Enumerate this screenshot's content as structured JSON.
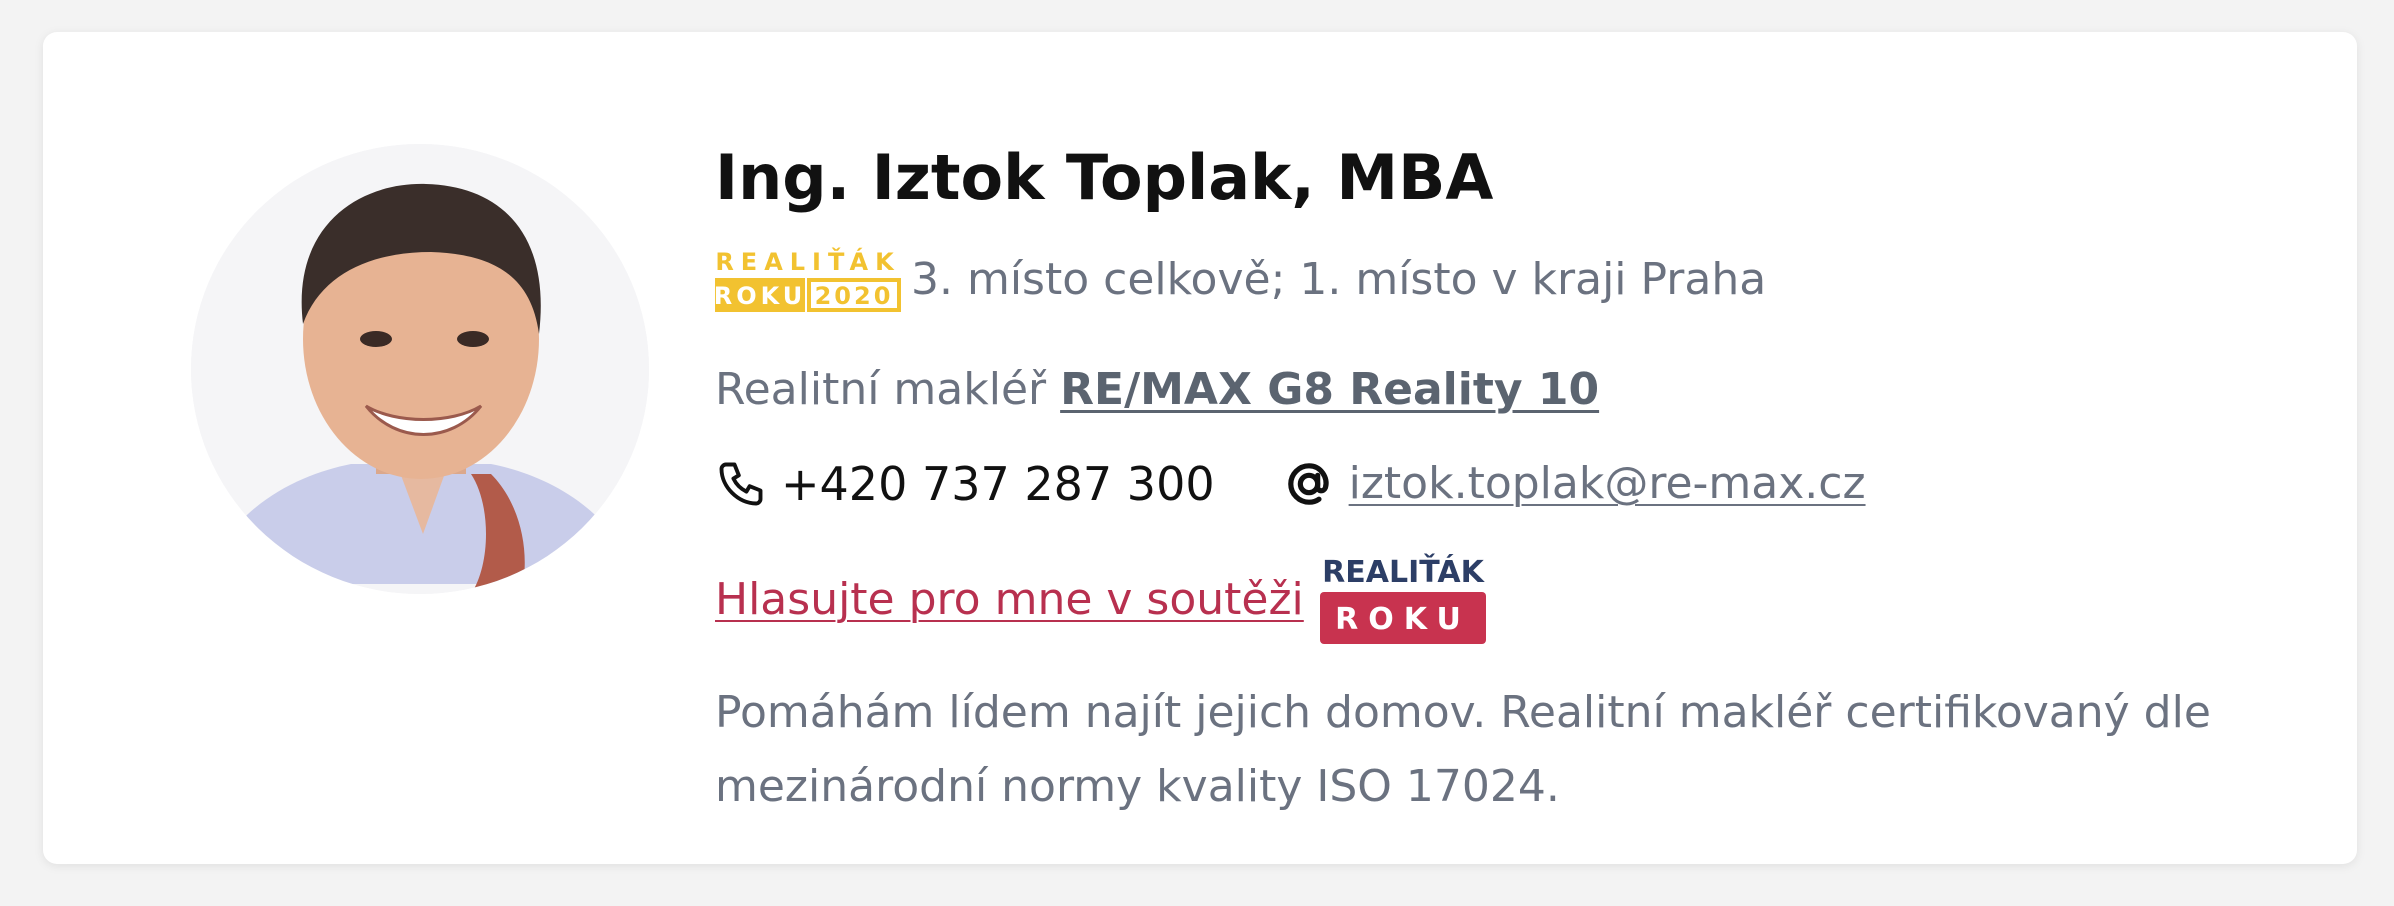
{
  "agent": {
    "name": "Ing. Iztok Toplak, MBA",
    "award_badge": {
      "line1": "REALIŤÁK",
      "line2": "ROKU",
      "year": "2020"
    },
    "award_text": "3. místo celkově; 1. místo v kraji Praha",
    "role_prefix": "Realitní makléř",
    "agency": "RE/MAX G8 Reality 10",
    "phone": "+420 737 287 300",
    "email": "iztok.toplak@re-max.cz",
    "vote_link": "Hlasujte pro mne v soutěži",
    "vote_badge": {
      "line1": "REALIŤÁK",
      "line2": "ROKU"
    },
    "bio": "Pomáhám lídem najít jejich domov. Realitní makléř certifikovaný dle mezinárodní normy kvality ISO 17024."
  },
  "icons": {
    "phone": "phone-icon",
    "email": "at-icon"
  },
  "colors": {
    "gold": "#f2c230",
    "vote_red": "#b8304f",
    "roku_red": "#c8334f",
    "navy": "#2c3e66",
    "text_gray": "#6b7280"
  }
}
